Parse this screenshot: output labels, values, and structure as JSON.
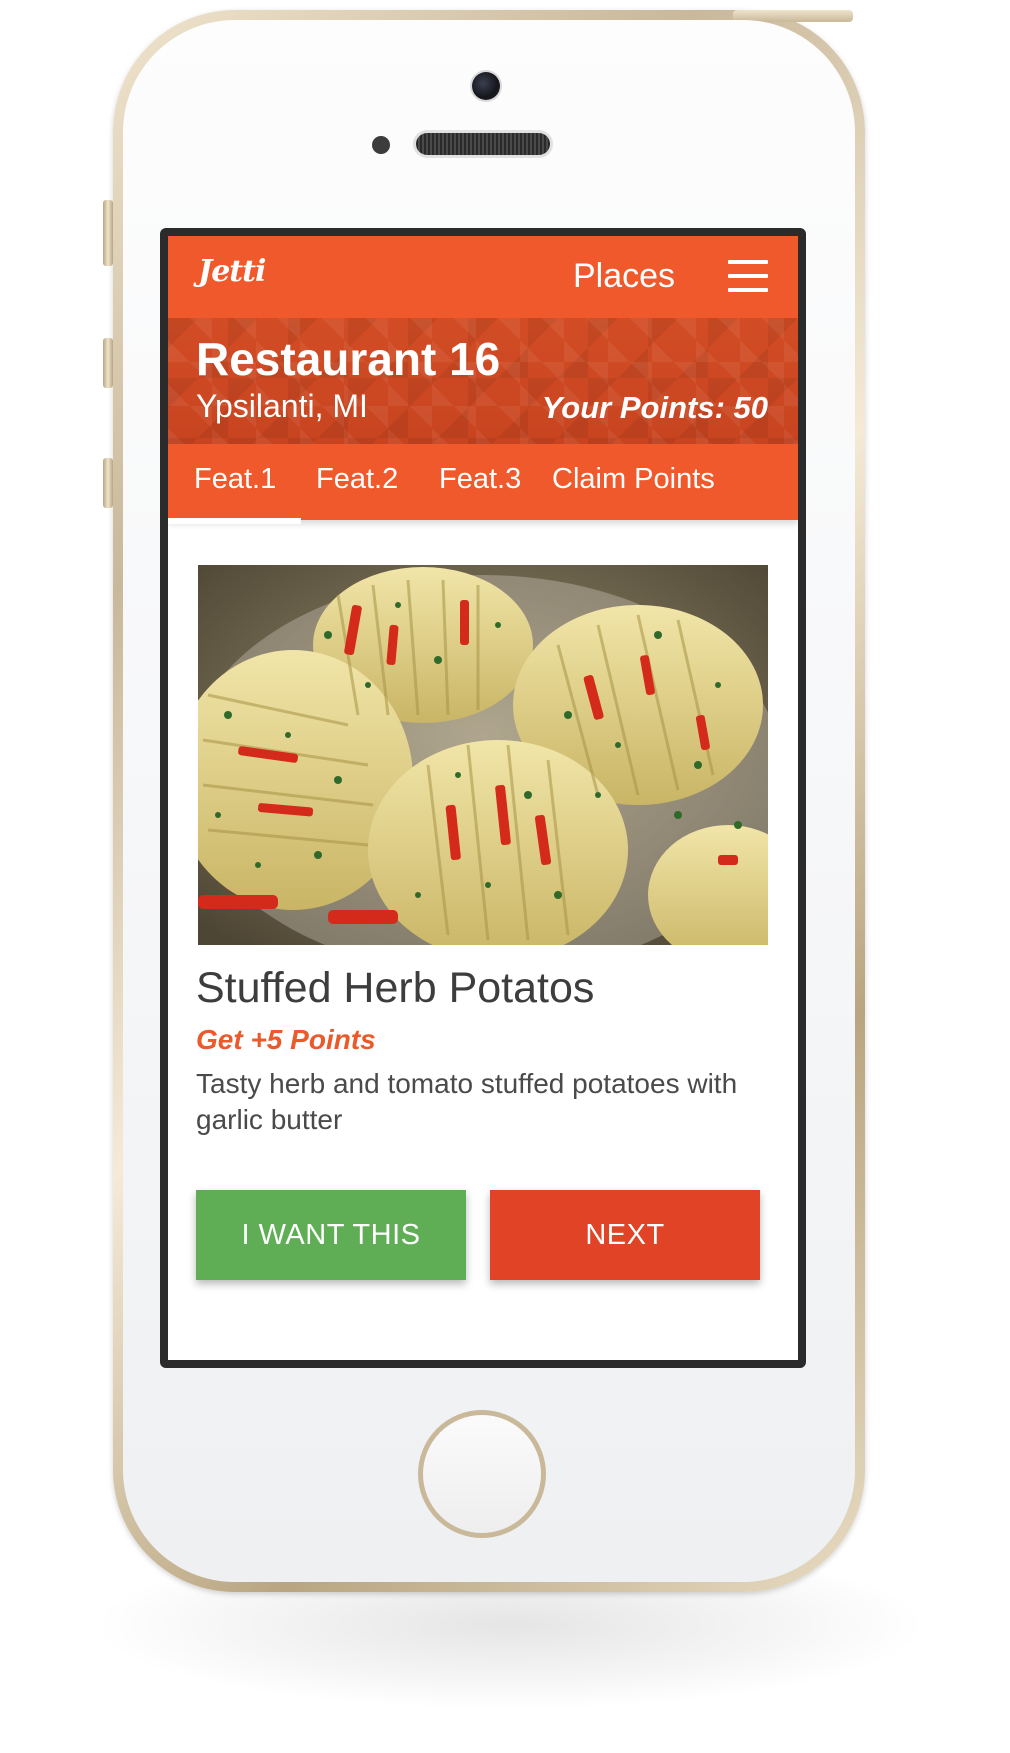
{
  "app": {
    "logo": "Jetti",
    "nav_title": "Places"
  },
  "restaurant": {
    "name": "Restaurant 16",
    "location": "Ypsilanti, MI",
    "points_label": "Your Points: 50"
  },
  "tabs": [
    {
      "label": "Feat.1",
      "active": true
    },
    {
      "label": "Feat.2",
      "active": false
    },
    {
      "label": "Feat.3",
      "active": false
    },
    {
      "label": "Claim Points",
      "active": false
    }
  ],
  "feature": {
    "title": "Stuffed Herb Potatos",
    "points": "Get +5 Points",
    "description": "Tasty herb and tomato stuffed potatoes with garlic butter"
  },
  "actions": {
    "want_label": "I WANT THIS",
    "next_label": "NEXT"
  },
  "colors": {
    "brand": "#f0592b",
    "want": "#5fae56",
    "next": "#e14326",
    "points_text": "#ea5a2a"
  }
}
